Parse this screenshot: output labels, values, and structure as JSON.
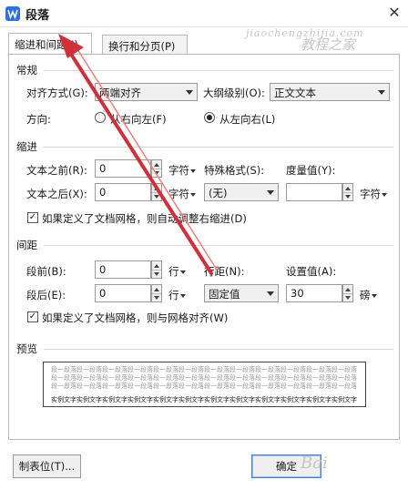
{
  "window": {
    "title": "段落",
    "close_glyph": "✕"
  },
  "tabs": [
    {
      "label": "缩进和间距(I)",
      "active": true
    },
    {
      "label": "换行和分页(P)",
      "active": false
    }
  ],
  "general": {
    "section_title": "常规",
    "alignment_label": "对齐方式(G):",
    "alignment_value": "两端对齐",
    "outline_label": "大纲级别(O):",
    "outline_value": "正文文本",
    "direction_label": "方向:",
    "rtl_label": "从右向左(F)",
    "ltr_label": "从左向右(L)",
    "direction_selected": "ltr"
  },
  "indent": {
    "section_title": "缩进",
    "before_label": "文本之前(R):",
    "before_value": "0",
    "before_unit": "字符",
    "after_label": "文本之后(X):",
    "after_value": "0",
    "after_unit": "字符",
    "special_label": "特殊格式(S):",
    "special_value": "(无)",
    "measure_label": "度量值(Y):",
    "measure_value": "",
    "measure_unit": "字符",
    "grid_checkbox_label": "如果定义了文档网格，则自动调整右缩进(D)",
    "grid_checked": true
  },
  "spacing": {
    "section_title": "间距",
    "before_label": "段前(B):",
    "before_value": "0",
    "before_unit": "行",
    "after_label": "段后(E):",
    "after_value": "0",
    "after_unit": "行",
    "line_label": "行距(N):",
    "line_value": "固定值",
    "setting_label": "设置值(A):",
    "setting_value": "30",
    "setting_unit": "磅",
    "grid_checkbox_label": "如果定义了文档网格，则与网格对齐(W)",
    "grid_checked": true
  },
  "preview": {
    "section_title": "预览",
    "prev_line_1": "段一段落段一段落段一段落段一段落段一段落段一段落段一段落段一段落段一段落段一段落段一段落段一段落",
    "prev_line_2": "段一段落段一段落段一段落段一段落段一段落段一段落段一段落段一段落段一段落段一段落段一段落段一段落",
    "prev_line_3": "段一段落段一段落段一段落段一段落段一段落段一段落段一段落段一段落段一段落段一段落段一段落段一段落",
    "sample_line": "实例文字实例文字实例文字实例文字实例文字实例文字实例文字实例文字实例文字实例文字实例文字实例文字"
  },
  "buttons": {
    "tabs_label": "制表位(T)...",
    "ok_label": "确定"
  },
  "watermark": {
    "top_text": "jiaochengzhijia.com",
    "top_cn": "教程之家",
    "bottom_text": "Bai"
  },
  "colors": {
    "annotation_arrow": "#d0303a",
    "app_icon": "#2f6fe0"
  }
}
